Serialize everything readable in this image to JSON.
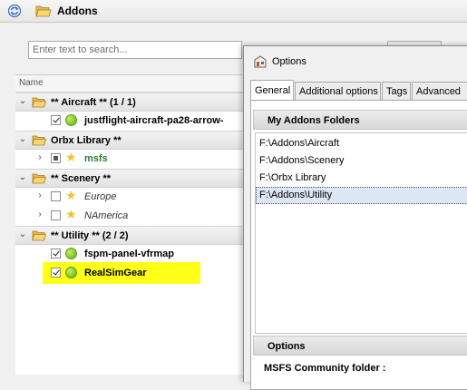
{
  "toolbar": {
    "title": "Addons",
    "icons": [
      "refresh-icon",
      "folder-open-icon"
    ]
  },
  "search": {
    "placeholder": "Enter text to search..."
  },
  "tree": {
    "column_header": "Name",
    "groups": [
      {
        "label": "** Aircraft ** (1 / 1)",
        "expanded": true,
        "items": [
          {
            "label": "justflight-aircraft-pa28-arrow-",
            "checked": true,
            "icon": "green-dot-icon"
          }
        ]
      },
      {
        "label": "Orbx Library **",
        "expanded": true,
        "items": [
          {
            "label": "msfs",
            "state": "partial",
            "icon": "star-icon"
          }
        ]
      },
      {
        "label": "** Scenery **",
        "expanded": true,
        "items": [
          {
            "label": "Europe",
            "checked": false,
            "icon": "star-icon"
          },
          {
            "label": "NAmerica",
            "checked": false,
            "icon": "star-icon"
          }
        ]
      },
      {
        "label": "** Utility ** (2 / 2)",
        "expanded": true,
        "items": [
          {
            "label": "fspm-panel-vfrmap",
            "checked": true,
            "icon": "green-dot-icon"
          },
          {
            "label": "RealSimGear",
            "checked": true,
            "icon": "green-dot-icon",
            "highlighted": true
          }
        ]
      }
    ]
  },
  "dialog": {
    "title": "Options",
    "tabs": [
      "General",
      "Additional options",
      "Tags",
      "Advanced"
    ],
    "active_tab": "General",
    "addons_section": "My Addons Folders",
    "folders": [
      "F:\\Addons\\Aircraft",
      "F:\\Addons\\Scenery",
      "F:\\Orbx Library",
      "F:\\Addons\\Utility"
    ],
    "selected_folder": "F:\\Addons\\Utility",
    "options_section": "Options",
    "community_label": "MSFS Community folder :"
  },
  "colors": {
    "highlight": "#ffff17",
    "green_text": "#2e7d32",
    "selection": "#dce6f5"
  }
}
